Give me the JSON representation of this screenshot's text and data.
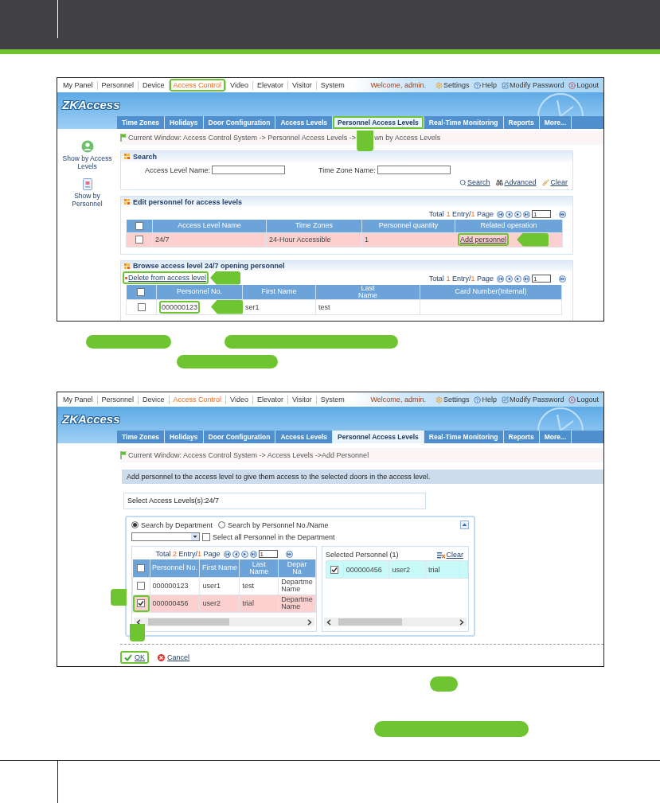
{
  "screens": [
    {
      "kind": "levels",
      "menu": [
        {
          "label": "My Panel",
          "selected": false,
          "highlighted": false
        },
        {
          "label": "Personnel",
          "selected": false,
          "highlighted": false
        },
        {
          "label": "Device",
          "selected": false,
          "highlighted": false
        },
        {
          "label": "Access Control",
          "selected": true,
          "highlighted": true
        },
        {
          "label": "Video",
          "selected": false,
          "highlighted": false
        },
        {
          "label": "Elevator",
          "selected": false,
          "highlighted": false
        },
        {
          "label": "Visitor",
          "selected": false,
          "highlighted": false
        },
        {
          "label": "System",
          "selected": false,
          "highlighted": false
        }
      ],
      "welcome": "Welcome, admin.",
      "top_links": [
        "Settings",
        "Help",
        "Modify Password",
        "Logout"
      ],
      "logo": "ZKAccess",
      "tabs": [
        {
          "label": "Time Zones",
          "selected": false,
          "highlighted": false
        },
        {
          "label": "Holidays",
          "selected": false,
          "highlighted": false
        },
        {
          "label": "Door Configuration",
          "selected": false,
          "highlighted": false
        },
        {
          "label": "Access Levels",
          "selected": false,
          "highlighted": false
        },
        {
          "label": "Personnel Access Levels",
          "selected": true,
          "highlighted": true
        },
        {
          "label": "Real-Time Monitoring",
          "selected": false,
          "highlighted": false
        },
        {
          "label": "Reports",
          "selected": false,
          "highlighted": false
        },
        {
          "label": "More...",
          "selected": false,
          "highlighted": false
        }
      ],
      "sidebar": [
        "Show by Access Levels",
        "Show by Personnel"
      ],
      "breadcrumb": [
        "Current Window: Access Control System -> Personnel Access Levels ->",
        "wn by Access Levels"
      ],
      "search": {
        "title": "Search",
        "fields": [
          "Access Level Name:",
          "Time Zone Name:"
        ],
        "actions": [
          "Search",
          "Advanced",
          "Clear"
        ]
      },
      "edit": {
        "title": "Edit personnel for access levels",
        "pager": {
          "total_label": "Total",
          "count": "1",
          "entry_label": "Entry/",
          "pages": "1",
          "page_label": "Page",
          "page": "1"
        },
        "header_checked": false,
        "columns": [
          "Access Level Name",
          "Time Zones",
          "Personnel quantity",
          "Related operation"
        ],
        "rows": [
          {
            "checked": false,
            "selected": true,
            "cells": [
              "24/7",
              "24-Hour Accessible",
              "1"
            ],
            "link": "Add personnel",
            "link_highlighted": true
          }
        ]
      },
      "browse": {
        "title": "Browse access level 24/7 opening personnel",
        "action": "Delete from access level",
        "action_highlighted": true,
        "pager": {
          "total_label": "Total",
          "count": "1",
          "entry_label": "Entry/",
          "pages": "1",
          "page_label": "Page",
          "page": "1"
        },
        "header_checked": false,
        "columns": [
          "Personnel No.",
          "First Name",
          "Last Name",
          "Card Number(Internal)"
        ],
        "rows": [
          {
            "checked": false,
            "highlighted": true,
            "cells": [
              "000000123",
              "ser1",
              "test"
            ]
          }
        ]
      }
    },
    {
      "kind": "add",
      "menu": [
        {
          "label": "My Panel",
          "selected": false,
          "highlighted": false
        },
        {
          "label": "Personnel",
          "selected": false,
          "highlighted": false
        },
        {
          "label": "Device",
          "selected": false,
          "highlighted": false
        },
        {
          "label": "Access Control",
          "selected": true,
          "highlighted": false
        },
        {
          "label": "Video",
          "selected": false,
          "highlighted": false
        },
        {
          "label": "Elevator",
          "selected": false,
          "highlighted": false
        },
        {
          "label": "Visitor",
          "selected": false,
          "highlighted": false
        },
        {
          "label": "System",
          "selected": false,
          "highlighted": false
        }
      ],
      "welcome": "Welcome, admin.",
      "top_links": [
        "Settings",
        "Help",
        "Modify Password",
        "Logout"
      ],
      "logo": "ZKAccess",
      "tabs": [
        {
          "label": "Time Zones",
          "selected": false,
          "highlighted": false
        },
        {
          "label": "Holidays",
          "selected": false,
          "highlighted": false
        },
        {
          "label": "Door Configuration",
          "selected": false,
          "highlighted": false
        },
        {
          "label": "Access Levels",
          "selected": false,
          "highlighted": false
        },
        {
          "label": "Personnel Access Levels",
          "selected": true,
          "highlighted": false
        },
        {
          "label": "Real-Time Monitoring",
          "selected": false,
          "highlighted": false
        },
        {
          "label": "Reports",
          "selected": false,
          "highlighted": false
        },
        {
          "label": "More...",
          "selected": false,
          "highlighted": false
        }
      ],
      "breadcrumb": [
        "Current Window: Access Control System -> Access Levels ->Add Personnel"
      ],
      "info": "Add personnel to the access level to give them access to the selected doors in the access level.",
      "select_levels": "Select Access Levels(s):24/7",
      "radios": [
        {
          "label": "Search by Department",
          "selected": true
        },
        {
          "label": "Search by Personnel No./Name",
          "selected": false
        }
      ],
      "select_all": {
        "label": "Select all Personnel in the Department",
        "checked": false
      },
      "pager": {
        "total_label": "Total",
        "count": "2",
        "entry_label": "Entry/",
        "pages": "1",
        "page_label": "Page",
        "page": "1"
      },
      "header_checked": false,
      "columns": [
        "Personnel No.",
        "First Name",
        "Last Name",
        "Depar Na"
      ],
      "rows": [
        {
          "checked": false,
          "selected": false,
          "highlighted": false,
          "cells": [
            "000000123",
            "user1",
            "test",
            "Departme Name"
          ]
        },
        {
          "checked": true,
          "selected": true,
          "highlighted": true,
          "cells": [
            "000000456",
            "user2",
            "trial",
            "Departme Name"
          ]
        }
      ],
      "selected_title": "Selected Personnel (1)",
      "clear": "Clear",
      "selected_rows": [
        {
          "checked": true,
          "cells": [
            "000000456",
            "user2",
            "trial"
          ]
        }
      ],
      "buttons": [
        {
          "kind": "ok",
          "label": "OK",
          "highlighted": true
        },
        {
          "kind": "cancel",
          "label": "Cancel",
          "highlighted": false
        }
      ]
    }
  ]
}
